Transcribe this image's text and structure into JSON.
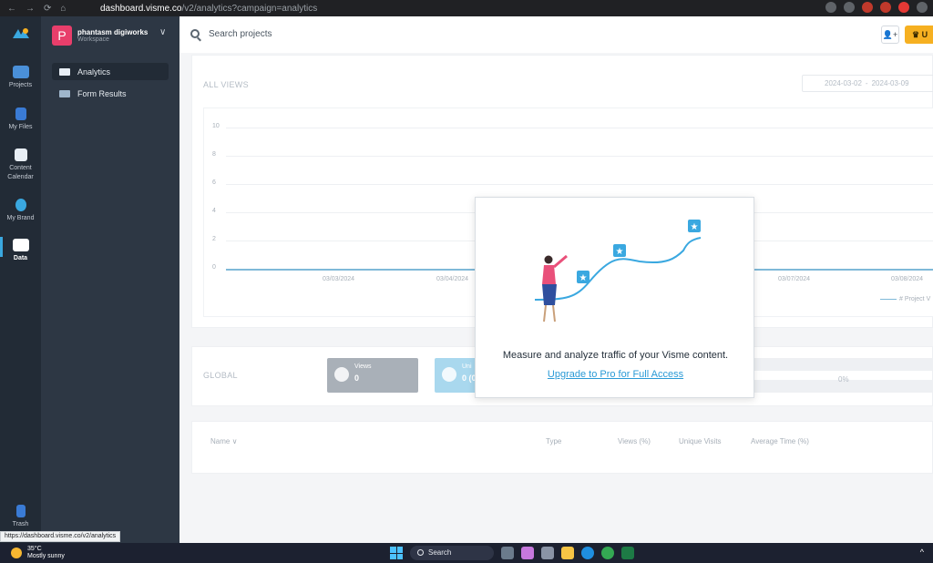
{
  "browser": {
    "nav": [
      "←",
      "→",
      "⟳",
      "⌂"
    ],
    "url_host": "dashboard.visme.co",
    "url_path": "/v2/analytics?campaign=analytics",
    "status_url": "https://dashboard.visme.co/v2/analytics"
  },
  "rail": {
    "items": [
      {
        "label": "Projects",
        "icon": "projects-icon"
      },
      {
        "label": "My Files",
        "icon": "my-files-icon"
      },
      {
        "label": "Content Calendar",
        "icon": "calendar-icon"
      },
      {
        "label": "My Brand",
        "icon": "brand-icon"
      },
      {
        "label": "Data",
        "icon": "data-icon"
      },
      {
        "label": "Trash",
        "icon": "trash-icon"
      }
    ]
  },
  "workspace": {
    "initial": "P",
    "name": "phantasm digiworks",
    "subtitle": "Workspace"
  },
  "sidebar": {
    "items": [
      {
        "label": "Analytics",
        "icon": "analytics-icon",
        "active": true
      },
      {
        "label": "Form Results",
        "icon": "form-results-icon",
        "active": false
      }
    ]
  },
  "topbar": {
    "search_placeholder": "Search projects",
    "upgrade_label": "U"
  },
  "all_views": {
    "title": "ALL VIEWS",
    "date_from": "2024-03-02",
    "date_to": "2024-03-09",
    "date_sep": "-"
  },
  "chart_data": {
    "type": "line",
    "y_ticks": [
      "10",
      "8",
      "6",
      "4",
      "2",
      "0"
    ],
    "x": [
      "03/03/2024",
      "03/04/2024",
      "03/07/2024",
      "03/08/2024"
    ],
    "series": [
      {
        "name": "# Project V",
        "values": [
          0,
          0,
          0,
          0
        ]
      }
    ],
    "ylim": [
      0,
      10
    ],
    "grid": true,
    "legend": "bottom-right"
  },
  "global": {
    "title": "GLOBAL",
    "views_label": "Views",
    "views_value": "0",
    "unique_label": "Uni",
    "unique_value": "0 (0",
    "percent": "0%"
  },
  "table": {
    "headers": [
      "Name ∨",
      "Type",
      "Views (%)",
      "Unique Visits",
      "Average Time (%)"
    ]
  },
  "modal": {
    "message": "Measure and analyze traffic of your Visme content.",
    "link": "Upgrade to Pro for Full Access"
  },
  "taskbar": {
    "temp": "35°C",
    "weather": "Mostly sunny",
    "search": "Search"
  },
  "colors": {
    "rail_bg": "#222b36",
    "sidebar_bg": "#2d3744",
    "accent": "#2a9ad6",
    "upgrade": "#f6b021",
    "views_card": "#a9b0b8",
    "unique_card": "#a9d8ee"
  }
}
